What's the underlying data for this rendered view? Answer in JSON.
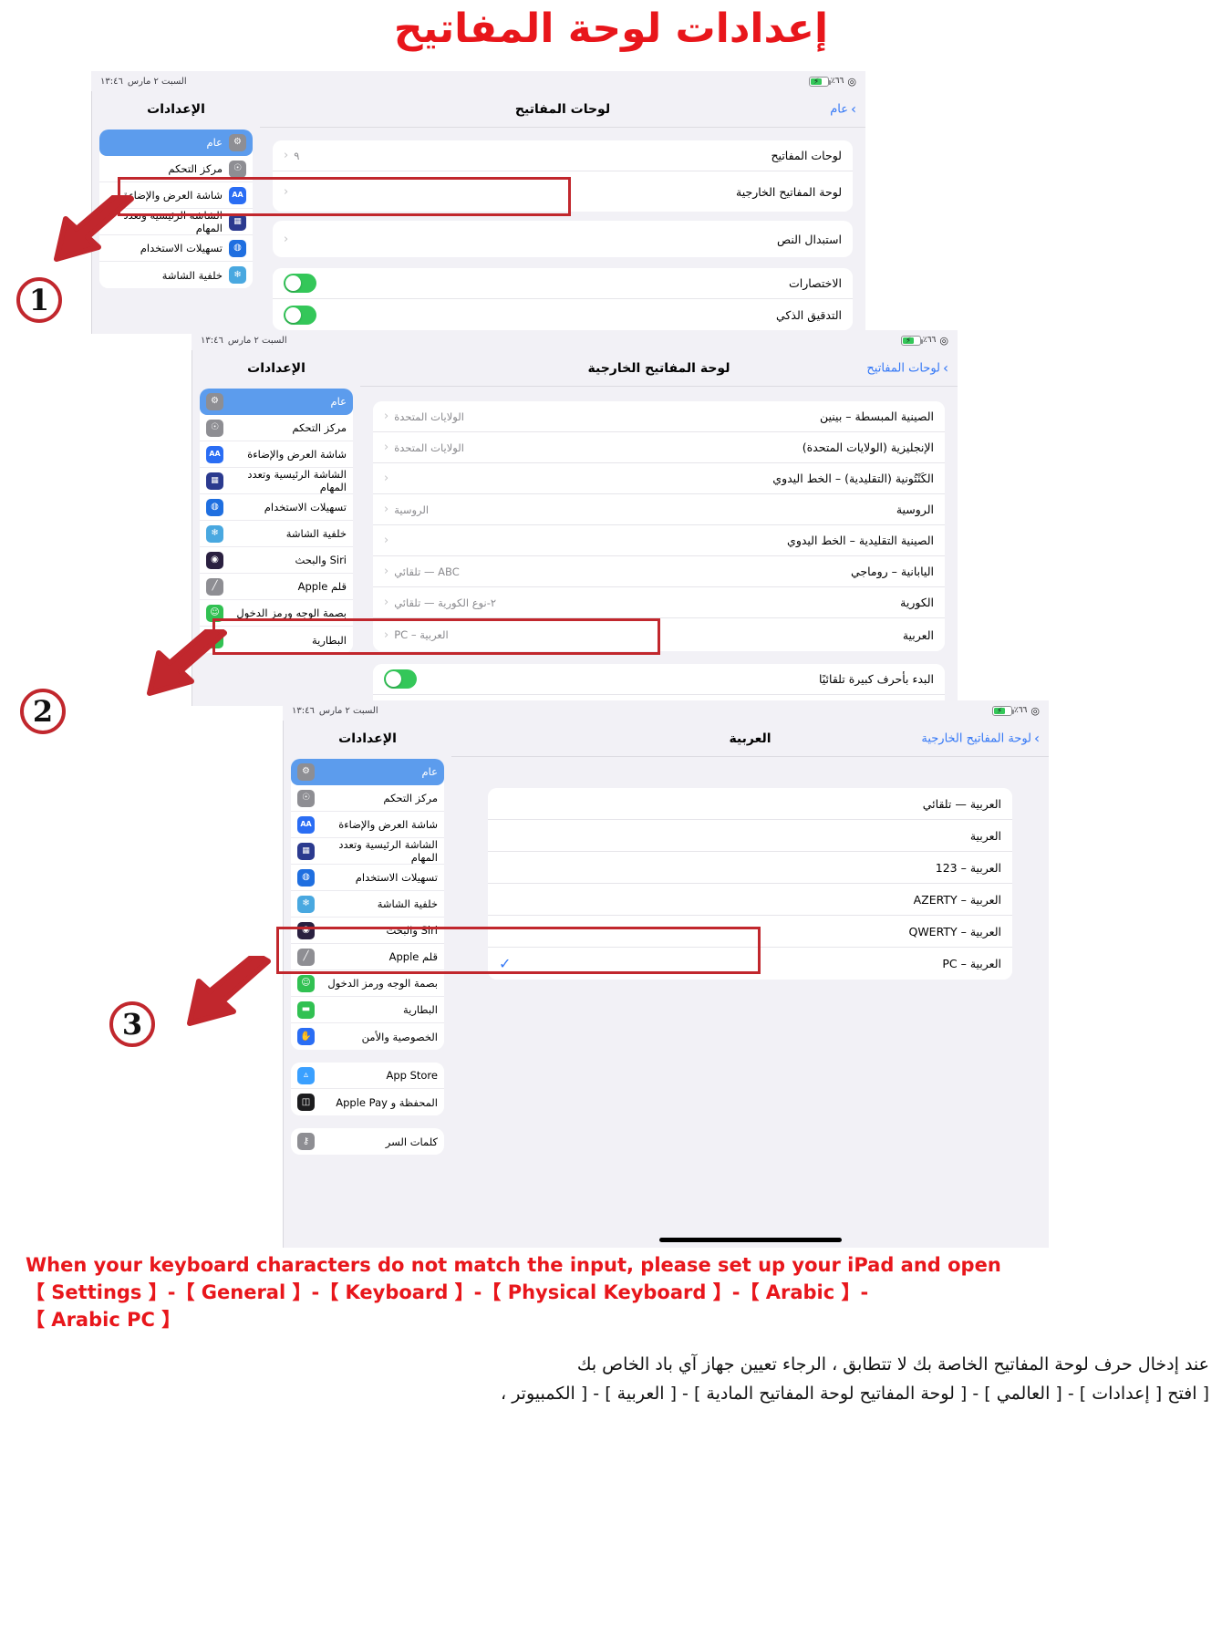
{
  "title": "إعدادات لوحة المفاتيح",
  "status_bar": {
    "battery": "٪٦٦",
    "time": "١٣:٤٦",
    "date": "السبت ٢ مارس"
  },
  "settings_sidebar": {
    "header": "الإعدادات",
    "groups": [
      {
        "items": [
          {
            "label": "عام",
            "icon": "gear-icon",
            "color": "#8e8e93",
            "selected": true
          },
          {
            "label": "مركز التحكم",
            "icon": "control-center-icon",
            "color": "#8e8e93",
            "selected": false
          },
          {
            "label": "شاشة العرض والإضاءة",
            "icon": "display-aa-icon",
            "color": "#2a6df4",
            "selected": false
          },
          {
            "label": "الشاشة الرئيسية وتعدد المهام",
            "icon": "home-screen-icon",
            "color": "#2b3a8f",
            "selected": false
          },
          {
            "label": "تسهيلات الاستخدام",
            "icon": "accessibility-icon",
            "color": "#1f6fe0",
            "selected": false
          },
          {
            "label": "خلفية الشاشة",
            "icon": "wallpaper-icon",
            "color": "#49a8e0",
            "selected": false
          },
          {
            "label": "Siri والبحث",
            "icon": "siri-icon",
            "color": "#2a2040",
            "selected": false
          },
          {
            "label": "قلم Apple",
            "icon": "apple-pencil-icon",
            "color": "#8e8e93",
            "selected": false
          },
          {
            "label": "بصمة الوجه ورمز الدخول",
            "icon": "face-id-icon",
            "color": "#31c152",
            "selected": false
          },
          {
            "label": "البطارية",
            "icon": "battery-icon",
            "color": "#31c152",
            "selected": false
          },
          {
            "label": "الخصوصية والأمن",
            "icon": "privacy-hand-icon",
            "color": "#2a6df4",
            "selected": false
          }
        ]
      },
      {
        "items": [
          {
            "label": "App Store",
            "icon": "app-store-icon",
            "color": "#3aa0ff",
            "selected": false
          },
          {
            "label": "المحفظة و Apple Pay",
            "icon": "wallet-icon",
            "color": "#1c1c1e",
            "selected": false
          }
        ]
      },
      {
        "items": [
          {
            "label": "كلمات السر",
            "icon": "passwords-key-icon",
            "color": "#8e8e93",
            "selected": false
          }
        ]
      }
    ]
  },
  "panel1": {
    "nav_title": "لوحات المفاتيح",
    "back_label": "عام",
    "group1": [
      {
        "label": "لوحات المفاتيح",
        "value": "٩",
        "type": "link"
      },
      {
        "label": "لوحة المفاتيح الخارجية",
        "value": "",
        "type": "link",
        "highlight": true
      }
    ],
    "group2": [
      {
        "label": "استبدال النص",
        "value": "",
        "type": "link"
      }
    ],
    "group3": [
      {
        "label": "الاختصارات",
        "type": "toggle",
        "on": true
      },
      {
        "label": "التدقيق الذكي",
        "type": "toggle",
        "on": true
      },
      {
        "label": "",
        "type": "toggle",
        "on": true
      },
      {
        "label": "",
        "type": "toggle",
        "on": true
      },
      {
        "label": "",
        "type": "toggle",
        "on": true
      },
      {
        "label": "",
        "type": "toggle",
        "on": true
      },
      {
        "label": "",
        "type": "toggle",
        "on": true
      },
      {
        "label": "",
        "type": "toggle",
        "on": true
      },
      {
        "label": "",
        "type": "toggle",
        "on": true
      }
    ],
    "group4": [
      {
        "label": "",
        "type": "toggle",
        "on": true
      }
    ]
  },
  "panel2": {
    "nav_title": "لوحة المفاتيح الخارجية",
    "back_label": "لوحات المفاتيح",
    "rows": [
      {
        "label": "الصينية المبسطة – بينين",
        "value": "الولايات المتحدة"
      },
      {
        "label": "الإنجليزية (الولايات المتحدة)",
        "value": "الولايات المتحدة"
      },
      {
        "label": "الكَنْتُونية (التقليدية) – الخط اليدوي",
        "value": ""
      },
      {
        "label": "الروسية",
        "value": "الروسية"
      },
      {
        "label": "الصينية التقليدية – الخط اليدوي",
        "value": ""
      },
      {
        "label": "اليابانية – روماجي",
        "value": "ABC — تلقائي"
      },
      {
        "label": "الكورية",
        "value": "٢-نوع الكورية — تلقائي"
      },
      {
        "label": "العربية",
        "value": "العربية – PC",
        "highlight": true
      }
    ],
    "toggles": [
      {
        "label": "البدء بأحرف كبيرة تلقائيًا",
        "on": true
      },
      {
        "label": "",
        "on": true
      },
      {
        "label": "",
        "on": true
      },
      {
        "label": "",
        "on": true
      }
    ]
  },
  "panel3": {
    "nav_title": "العربية",
    "back_label": "لوحة المفاتيح الخارجية",
    "rows": [
      {
        "label": "العربية — تلقائي",
        "checked": false
      },
      {
        "label": "العربية",
        "checked": false
      },
      {
        "label": "العربية – 123",
        "checked": false
      },
      {
        "label": "العربية – AZERTY",
        "checked": false
      },
      {
        "label": "العربية – QWERTY",
        "checked": false
      },
      {
        "label": "العربية – PC",
        "checked": true,
        "highlight": true
      }
    ],
    "check_glyph": "✓"
  },
  "steps": {
    "one": "1",
    "two": "2",
    "three": "3"
  },
  "caption_en_lines": [
    "When your keyboard characters do not match the input, please set up your iPad and open",
    "【 Settings 】-【 General 】-【 Keyboard 】-【 Physical Keyboard 】-【 Arabic 】-",
    "【 Arabic PC 】"
  ],
  "caption_ar_lines": [
    "عند إدخال حرف لوحة المفاتيح الخاصة بك لا تتطابق ، الرجاء تعيين جهاز آي باد الخاص بك",
    "[ افتح [ إعدادات ] - [ العالمي ] - [ لوحة المفاتيح لوحة المفاتيح المادية ] - [ العربية ] - [ الكمبيوتر ،"
  ],
  "colors": {
    "accent_red": "#c1272d",
    "ios_blue": "#3478f6",
    "selected_blue": "#5c9ced",
    "toggle_green": "#34c759"
  }
}
